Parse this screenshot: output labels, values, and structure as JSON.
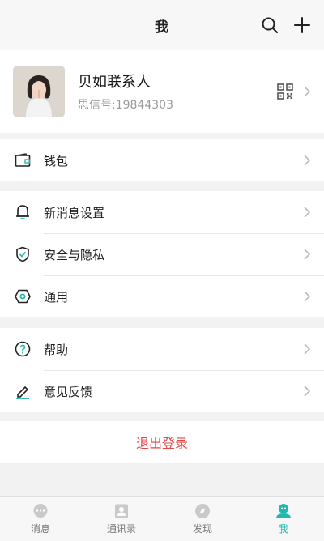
{
  "header": {
    "title": "我"
  },
  "profile": {
    "name": "贝如联系人",
    "id_line": "思信号:19844303"
  },
  "sections": {
    "wallet": {
      "label": "钱包"
    },
    "notify": {
      "label": "新消息设置"
    },
    "privacy": {
      "label": "安全与隐私"
    },
    "general": {
      "label": "通用"
    },
    "help": {
      "label": "帮助"
    },
    "feedback": {
      "label": "意见反馈"
    }
  },
  "logout": {
    "label": "退出登录"
  },
  "tabs": [
    {
      "label": "消息",
      "icon": "chat-bubble-icon"
    },
    {
      "label": "通讯录",
      "icon": "contacts-icon"
    },
    {
      "label": "发现",
      "icon": "compass-icon"
    },
    {
      "label": "我",
      "icon": "me-icon",
      "active": true
    }
  ],
  "colors": {
    "accent": "#22b8b0",
    "danger": "#e64545",
    "background": "#f2f2f2"
  }
}
